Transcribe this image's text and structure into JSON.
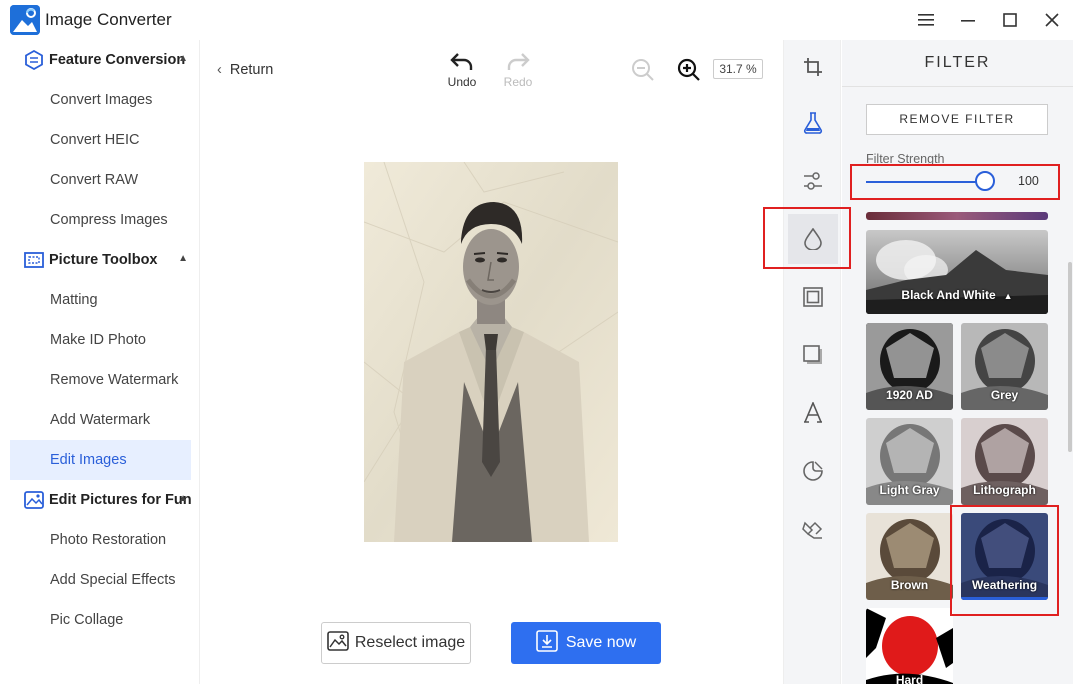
{
  "app": {
    "title": "Image Converter"
  },
  "window": {
    "minimize": "–",
    "maximize": "☐",
    "close": "✕"
  },
  "sidebar": {
    "sections": [
      {
        "label": "Feature Conversion",
        "items": [
          "Convert Images",
          "Convert HEIC",
          "Convert RAW",
          "Compress Images"
        ]
      },
      {
        "label": "Picture Toolbox",
        "items": [
          "Matting",
          "Make ID Photo",
          "Remove Watermark",
          "Add Watermark",
          "Edit Images"
        ]
      },
      {
        "label": "Edit Pictures for Fun",
        "items": [
          "Photo Restoration",
          "Add Special Effects",
          "Pic Collage"
        ]
      }
    ],
    "active_item": "Edit Images"
  },
  "toolbar": {
    "return_label": "Return",
    "undo_label": "Undo",
    "redo_label": "Redo",
    "zoom_value": "31.7 %"
  },
  "actions": {
    "reselect_label": "Reselect image",
    "save_label": "Save now"
  },
  "filter_panel": {
    "title": "FILTER",
    "remove_label": "REMOVE FILTER",
    "strength_label": "Filter Strength",
    "strength_value": "100",
    "strength_fraction": 1.0,
    "category": "Black And White",
    "filters": [
      "1920 AD",
      "Grey",
      "Light Gray",
      "Lithograph",
      "Brown",
      "Weathering",
      "Hard"
    ],
    "selected_filter": "Weathering"
  },
  "colors": {
    "accent": "#2e6ff0",
    "highlight": "#e02020",
    "active_bg": "#e7efff"
  }
}
